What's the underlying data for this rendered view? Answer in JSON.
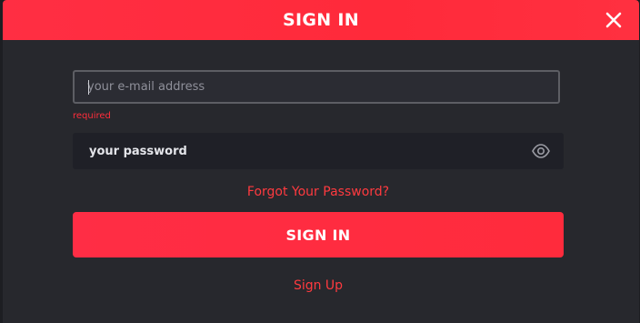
{
  "modal": {
    "title": "SIGN IN",
    "close_icon": "close-icon"
  },
  "form": {
    "email": {
      "placeholder": "your e-mail address",
      "value": "",
      "error": "required"
    },
    "password": {
      "placeholder": "your password",
      "value": "",
      "toggle_icon": "eye-icon"
    },
    "forgot_label": "Forgot Your Password?",
    "submit_label": "SIGN IN",
    "signup_label": "Sign Up"
  },
  "colors": {
    "accent": "#ff2d3b",
    "header_gradient_start": "#ff2e43",
    "modal_bg": "#27282d",
    "input_bg": "#2b2c33",
    "password_bg": "#1f2027"
  }
}
